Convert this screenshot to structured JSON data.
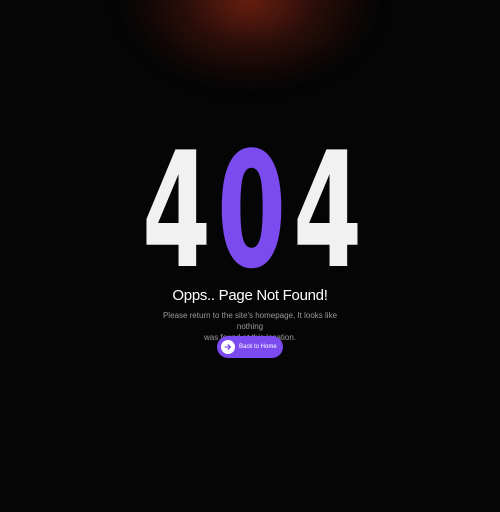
{
  "error": {
    "code_first": "4",
    "code_middle": "0",
    "code_last": "4"
  },
  "heading": "Opps.. Page Not Found!",
  "description_line1": "Please return to the site's homepage, It looks like nothing",
  "description_line2": "was found at this location.",
  "back_button": {
    "label": "Back to Home",
    "icon": "arrow-right-icon"
  },
  "colors": {
    "background": "#050505",
    "accent": "#7c4bf0",
    "digit": "#f1f1f1",
    "glow": "#8c2814"
  }
}
